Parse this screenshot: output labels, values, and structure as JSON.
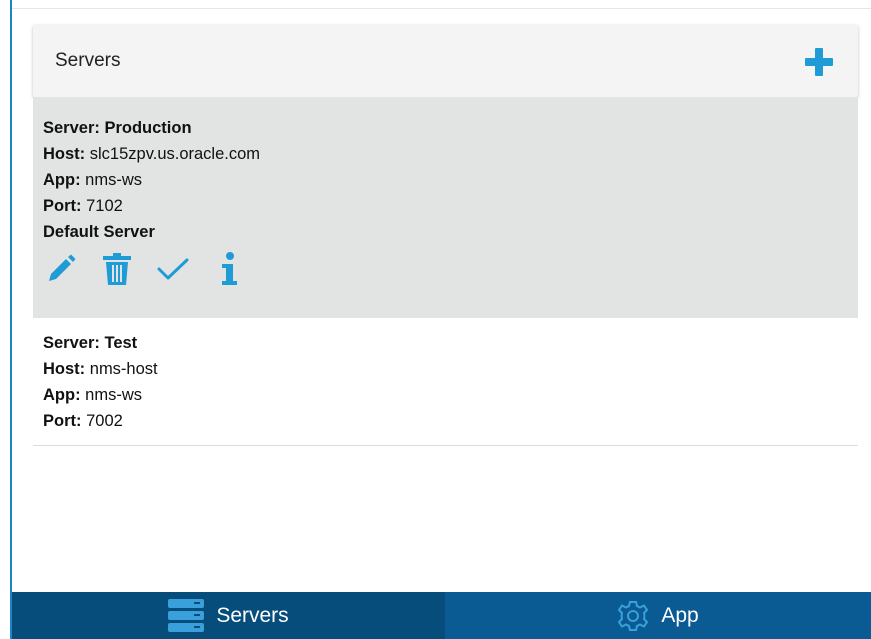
{
  "panel": {
    "title": "Servers",
    "add_icon": "plus-icon"
  },
  "servers": [
    {
      "name_label": "Server:",
      "name": "Production",
      "host_label": "Host:",
      "host": "slc15zpv.us.oracle.com",
      "app_label": "App:",
      "app": "nms-ws",
      "port_label": "Port:",
      "port": "7102",
      "default_text": "Default Server",
      "selected": true
    },
    {
      "name_label": "Server:",
      "name": "Test",
      "host_label": "Host:",
      "host": "nms-host",
      "app_label": "App:",
      "app": "nms-ws",
      "port_label": "Port:",
      "port": "7002",
      "selected": false
    }
  ],
  "actions": [
    "edit-icon",
    "trash-icon",
    "check-icon",
    "info-icon"
  ],
  "tabs": [
    {
      "label": "Servers",
      "icon": "server-stack-icon",
      "active": true
    },
    {
      "label": "App",
      "icon": "gear-icon",
      "active": false
    }
  ],
  "colors": {
    "accent": "#1f9bd6",
    "tab_active": "#064d7c",
    "tab_inactive": "#0a5b93",
    "selected_bg": "#e2e3e3"
  }
}
